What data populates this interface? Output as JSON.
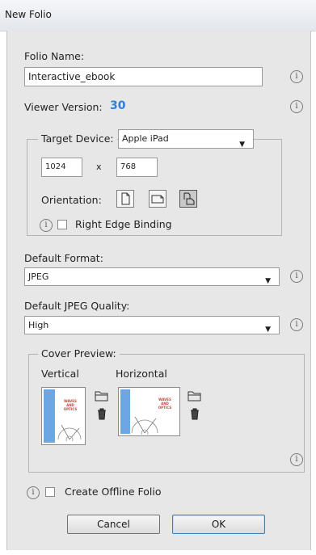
{
  "window": {
    "title": "New Folio"
  },
  "folio": {
    "name_label": "Folio Name:",
    "name_value": "Interactive_ebook"
  },
  "viewer": {
    "label": "Viewer Version:",
    "value": "30",
    "value_color": "#2f7fd8"
  },
  "target": {
    "label": "Target Device:",
    "device": "Apple iPad",
    "width": "1024",
    "separator": "x",
    "height": "768",
    "orientation_label": "Orientation:",
    "right_edge_label": "Right Edge Binding"
  },
  "format": {
    "label": "Default Format:",
    "value": "JPEG"
  },
  "quality": {
    "label": "Default JPEG Quality:",
    "value": "High"
  },
  "cover": {
    "label": "Cover Preview:",
    "vertical_label": "Vertical",
    "horizontal_label": "Horizontal",
    "thumb_text": [
      "WAVES",
      "AND",
      "OPTICS"
    ]
  },
  "offline": {
    "label": "Create Offline Folio"
  },
  "buttons": {
    "cancel": "Cancel",
    "ok": "OK"
  },
  "info_glyph": "i",
  "icons": {
    "info": "info-icon",
    "dropdown": "chevron-down-icon",
    "portrait": "portrait-icon",
    "landscape": "landscape-icon",
    "both": "both-orientations-icon",
    "folder": "folder-icon",
    "trash": "trash-icon"
  }
}
